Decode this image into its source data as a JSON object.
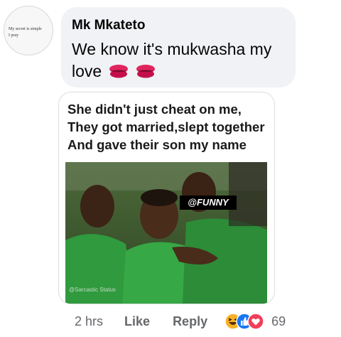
{
  "avatar": {
    "text": "My secret is simple\nI pray"
  },
  "comment": {
    "author": "Mk Mkateto",
    "text": "We know it's mukwasha my love",
    "emojis": [
      "kiss-mark-icon",
      "kiss-mark-icon"
    ]
  },
  "attachment": {
    "caption": "She didn't just cheat on me,\nThey got married,slept together\nAnd gave their son my name",
    "tag": "@FUNNY",
    "watermark": "@Sarcastic Status"
  },
  "actions": {
    "time": "2 hrs",
    "like": "Like",
    "reply": "Reply",
    "reaction_icons": [
      "haha-icon",
      "like-icon",
      "love-icon"
    ],
    "reaction_count": "69"
  },
  "colors": {
    "bubble": "#f0f2f5",
    "secondary_text": "#65676b",
    "like_blue": "#1877f2",
    "love_red": "#f33e58",
    "haha_yellow": "#f7b125"
  }
}
